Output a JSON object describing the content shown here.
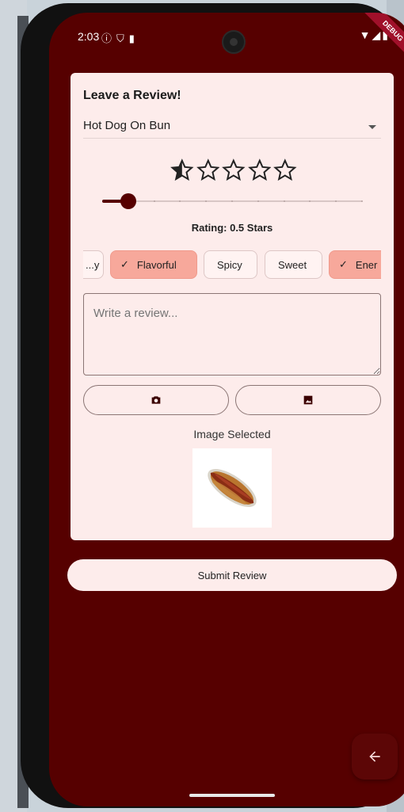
{
  "status_bar": {
    "time": "2:03",
    "left_icons": [
      "info-icon",
      "shield-icon",
      "sd-card-icon"
    ],
    "right_icons": [
      "wifi-icon",
      "signal-icon",
      "battery-icon"
    ],
    "debug_label": "DEBUG"
  },
  "review_card": {
    "title": "Leave a Review!",
    "item_dropdown": {
      "selected": "Hot Dog On Bun"
    },
    "rating": {
      "value": 0.5,
      "max": 5,
      "label": "Rating: 0.5 Stars"
    },
    "tags": [
      {
        "label": "...y",
        "selected": false
      },
      {
        "label": "Flavorful",
        "selected": true
      },
      {
        "label": "Spicy",
        "selected": false
      },
      {
        "label": "Sweet",
        "selected": false
      },
      {
        "label": "Ener",
        "selected": true
      }
    ],
    "review_input": {
      "placeholder": "Write a review...",
      "value": ""
    },
    "camera_button_icon": "camera-icon",
    "gallery_button_icon": "image-icon",
    "image_status": "Image Selected",
    "image_description": "hot-dog-image"
  },
  "submit_label": "Submit Review",
  "back_fab_icon": "arrow-left-icon",
  "colors": {
    "primary": "#560000",
    "card": "#fdeceb",
    "chip_selected": "#f7a89b"
  }
}
